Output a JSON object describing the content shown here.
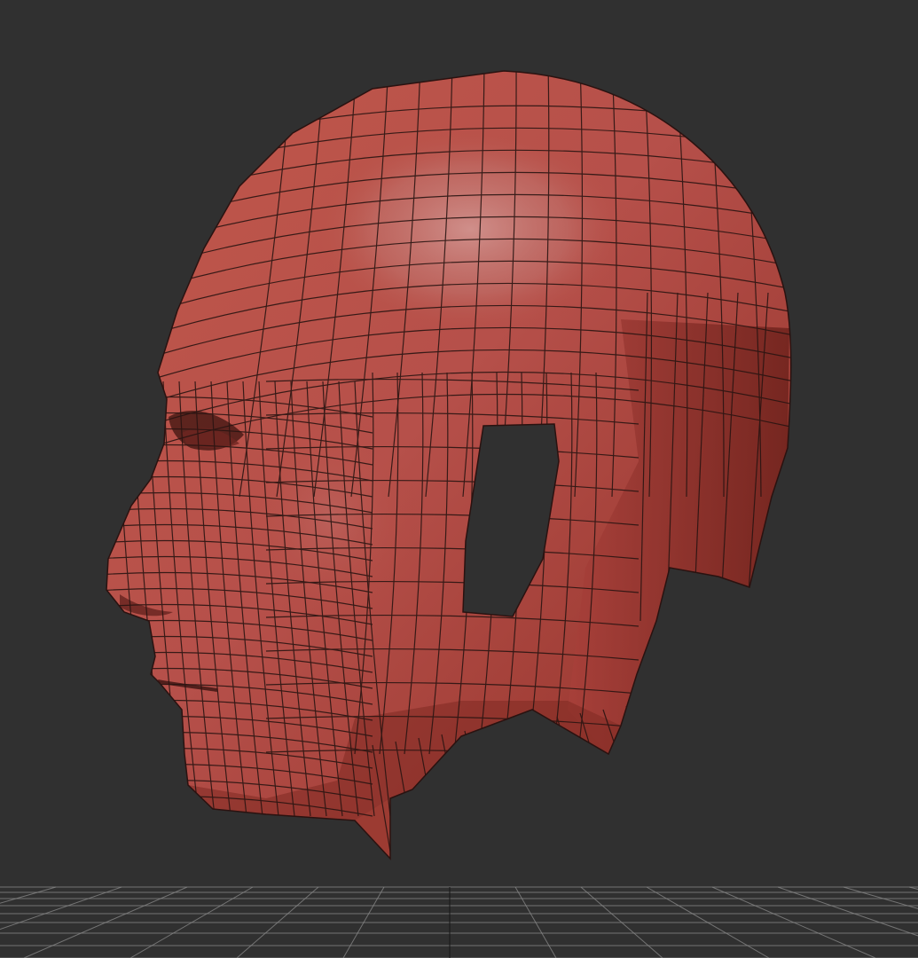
{
  "viewport": {
    "background_color": "#303030",
    "grid_color": "#8a8a8a",
    "grid_axis_color": "#1a1a1a"
  },
  "model": {
    "shape": "human-head-mesh",
    "display_mode": "shaded-with-wireframe",
    "base_color": "#b5483c",
    "highlight_color": "#c98a86",
    "shadow_color": "#7a2620",
    "wire_color": "#2a1512"
  }
}
